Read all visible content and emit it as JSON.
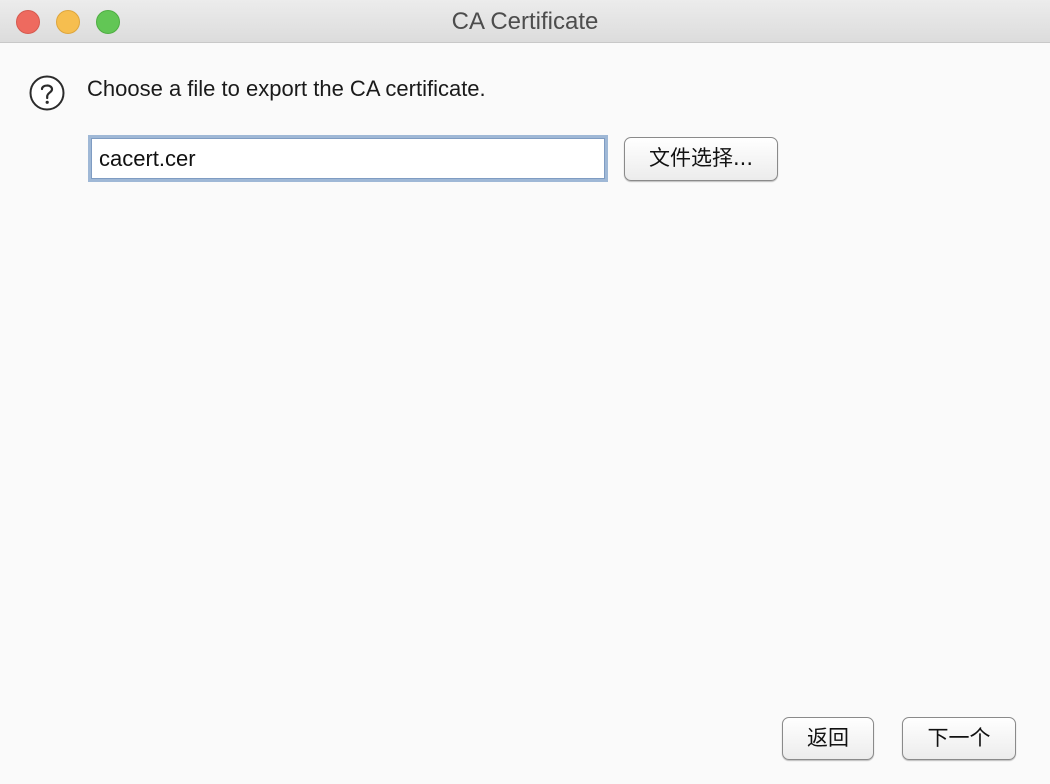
{
  "window": {
    "title": "CA Certificate"
  },
  "traffic_lights": {
    "close_color": "#ee6a5f",
    "minimize_color": "#f6be4f",
    "maximize_color": "#62c655"
  },
  "dialog": {
    "icon": "question-circle-icon",
    "prompt": "Choose a file to export the CA certificate.",
    "file_field": {
      "value": "cacert.cer"
    },
    "choose_file_label": "文件选择..."
  },
  "footer": {
    "back_label": "返回",
    "next_label": "下一个"
  }
}
